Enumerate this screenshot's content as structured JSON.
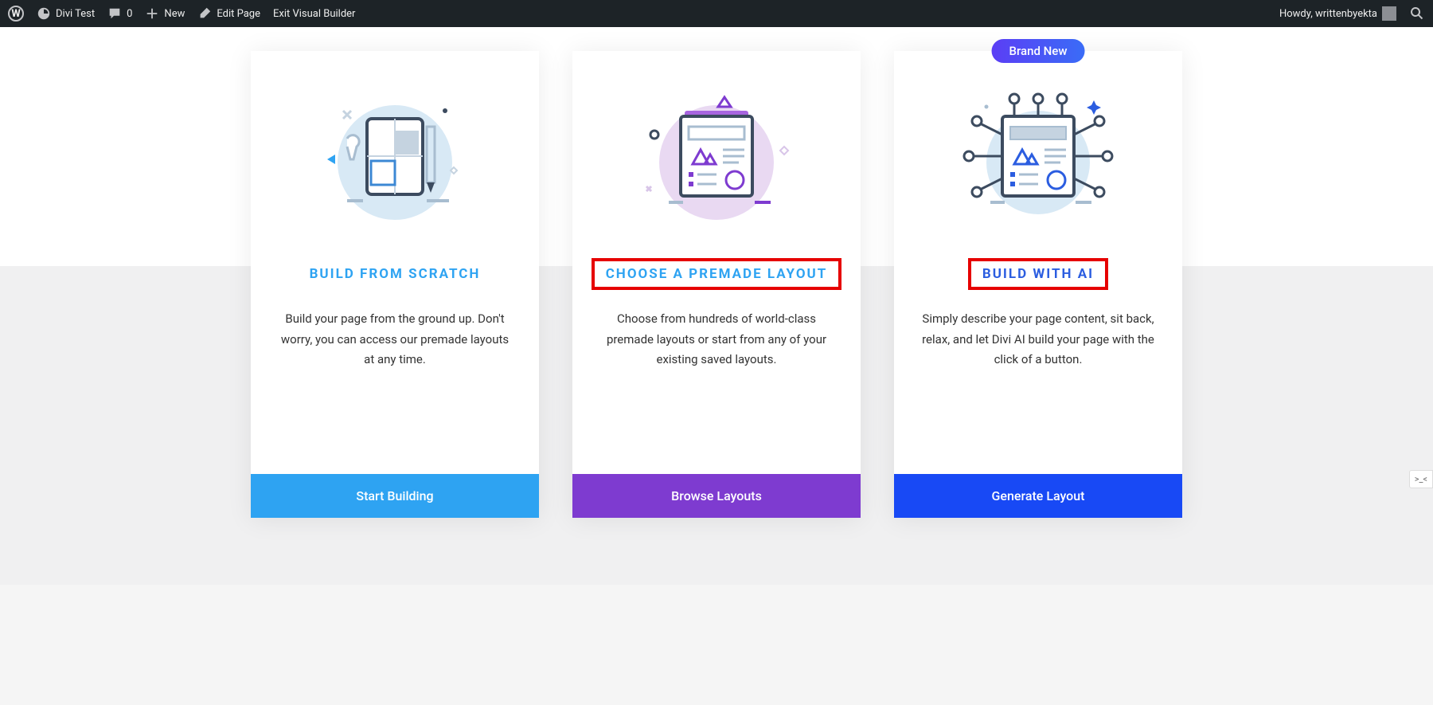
{
  "adminBar": {
    "siteName": "Divi Test",
    "commentsCount": "0",
    "newLabel": "New",
    "editPage": "Edit Page",
    "exitBuilder": "Exit Visual Builder",
    "greeting": "Howdy, writtenbyekta",
    "consoleBadge": ">_<"
  },
  "cards": [
    {
      "title": "BUILD FROM SCRATCH",
      "desc": "Build your page from the ground up. Don't worry, you can access our premade layouts at any time.",
      "button": "Start Building",
      "highlighted": false,
      "badge": null
    },
    {
      "title": "CHOOSE A PREMADE LAYOUT",
      "desc": "Choose from hundreds of world-class premade layouts or start from any of your existing saved layouts.",
      "button": "Browse Layouts",
      "highlighted": true,
      "badge": null
    },
    {
      "title": "BUILD WITH AI",
      "desc": "Simply describe your page content, sit back, relax, and let Divi AI build your page with the click of a button.",
      "button": "Generate Layout",
      "highlighted": true,
      "badge": "Brand New"
    }
  ]
}
